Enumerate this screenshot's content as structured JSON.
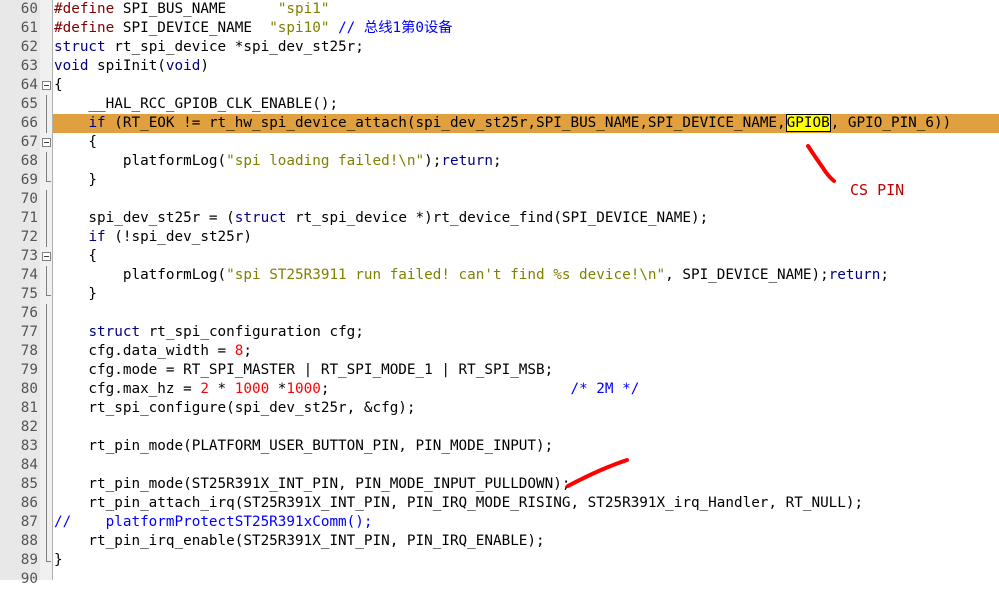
{
  "editor": {
    "lines": [
      {
        "num": "60",
        "fold": "none",
        "tokens": [
          {
            "t": "#define ",
            "c": "pp"
          },
          {
            "t": "SPI_BUS_NAME      ",
            "c": "op"
          },
          {
            "t": "\"spi1\"",
            "c": "str"
          }
        ]
      },
      {
        "num": "61",
        "fold": "none",
        "tokens": [
          {
            "t": "#define ",
            "c": "pp"
          },
          {
            "t": "SPI_DEVICE_NAME  ",
            "c": "op"
          },
          {
            "t": "\"spi10\"",
            "c": "str"
          },
          {
            "t": " // 总线1第0设备",
            "c": "cm"
          }
        ]
      },
      {
        "num": "62",
        "fold": "none",
        "tokens": [
          {
            "t": "struct",
            "c": "kw"
          },
          {
            "t": " rt_spi_device ",
            "c": "op"
          },
          {
            "t": "*",
            "c": "op"
          },
          {
            "t": "spi_dev_st25r;",
            "c": "op"
          }
        ]
      },
      {
        "num": "63",
        "fold": "none",
        "tokens": [
          {
            "t": "void",
            "c": "kw"
          },
          {
            "t": " spiInit(",
            "c": "op"
          },
          {
            "t": "void",
            "c": "kw"
          },
          {
            "t": ")",
            "c": "op"
          }
        ]
      },
      {
        "num": "64",
        "fold": "box",
        "tokens": [
          {
            "t": "{",
            "c": "op"
          }
        ]
      },
      {
        "num": "65",
        "fold": "line",
        "tokens": [
          {
            "t": "    __HAL_RCC_GPIOB_CLK_ENABLE();",
            "c": "op"
          }
        ]
      },
      {
        "num": "66",
        "fold": "line",
        "hl": true,
        "tokens": [
          {
            "t": "    ",
            "c": "op"
          },
          {
            "t": "if",
            "c": "kw"
          },
          {
            "t": " (RT_EOK != rt_hw_spi_device_attach(spi_dev_st25r,SPI_BUS_NAME,SPI_DEVICE_NAME,",
            "c": "op"
          },
          {
            "t": "GPIOB",
            "c": "gsel"
          },
          {
            "t": ", GPIO_PIN_6))",
            "c": "op"
          }
        ]
      },
      {
        "num": "67",
        "fold": "box",
        "tokens": [
          {
            "t": "    {",
            "c": "op"
          }
        ]
      },
      {
        "num": "68",
        "fold": "line",
        "tokens": [
          {
            "t": "        platformLog(",
            "c": "op"
          },
          {
            "t": "\"spi loading failed!\\n\"",
            "c": "str"
          },
          {
            "t": ");",
            "c": "op"
          },
          {
            "t": "return",
            "c": "kw"
          },
          {
            "t": ";",
            "c": "op"
          }
        ]
      },
      {
        "num": "69",
        "fold": "end",
        "tokens": [
          {
            "t": "    }",
            "c": "op"
          }
        ]
      },
      {
        "num": "70",
        "fold": "line",
        "tokens": []
      },
      {
        "num": "71",
        "fold": "line",
        "tokens": [
          {
            "t": "    spi_dev_st25r = (",
            "c": "op"
          },
          {
            "t": "struct",
            "c": "kw"
          },
          {
            "t": " rt_spi_device *)rt_device_find(SPI_DEVICE_NAME);",
            "c": "op"
          }
        ]
      },
      {
        "num": "72",
        "fold": "line",
        "tokens": [
          {
            "t": "    ",
            "c": "op"
          },
          {
            "t": "if",
            "c": "kw"
          },
          {
            "t": " (!spi_dev_st25r)",
            "c": "op"
          }
        ]
      },
      {
        "num": "73",
        "fold": "box",
        "tokens": [
          {
            "t": "    {",
            "c": "op"
          }
        ]
      },
      {
        "num": "74",
        "fold": "line",
        "tokens": [
          {
            "t": "        platformLog(",
            "c": "op"
          },
          {
            "t": "\"spi ST25R3911 run failed! can't find %s device!\\n\"",
            "c": "str"
          },
          {
            "t": ", SPI_DEVICE_NAME);",
            "c": "op"
          },
          {
            "t": "return",
            "c": "kw"
          },
          {
            "t": ";",
            "c": "op"
          }
        ]
      },
      {
        "num": "75",
        "fold": "end",
        "tokens": [
          {
            "t": "    }",
            "c": "op"
          }
        ]
      },
      {
        "num": "76",
        "fold": "line",
        "tokens": []
      },
      {
        "num": "77",
        "fold": "line",
        "tokens": [
          {
            "t": "    ",
            "c": "op"
          },
          {
            "t": "struct",
            "c": "kw"
          },
          {
            "t": " rt_spi_configuration cfg;",
            "c": "op"
          }
        ]
      },
      {
        "num": "78",
        "fold": "line",
        "tokens": [
          {
            "t": "    cfg.data_width = ",
            "c": "op"
          },
          {
            "t": "8",
            "c": "num"
          },
          {
            "t": ";",
            "c": "op"
          }
        ]
      },
      {
        "num": "79",
        "fold": "line",
        "tokens": [
          {
            "t": "    cfg.mode = RT_SPI_MASTER | RT_SPI_MODE_1 | RT_SPI_MSB;",
            "c": "op"
          }
        ]
      },
      {
        "num": "80",
        "fold": "line",
        "tokens": [
          {
            "t": "    cfg.max_hz = ",
            "c": "op"
          },
          {
            "t": "2",
            "c": "num"
          },
          {
            "t": " * ",
            "c": "op"
          },
          {
            "t": "1000",
            "c": "num"
          },
          {
            "t": " *",
            "c": "op"
          },
          {
            "t": "1000",
            "c": "num"
          },
          {
            "t": ";                            ",
            "c": "op"
          },
          {
            "t": "/* 2M */",
            "c": "cm"
          }
        ]
      },
      {
        "num": "81",
        "fold": "line",
        "tokens": [
          {
            "t": "    rt_spi_configure(spi_dev_st25r, &cfg);",
            "c": "op"
          }
        ]
      },
      {
        "num": "82",
        "fold": "line",
        "tokens": []
      },
      {
        "num": "83",
        "fold": "line",
        "tokens": [
          {
            "t": "    rt_pin_mode(PLATFORM_USER_BUTTON_PIN, PIN_MODE_INPUT);",
            "c": "op"
          }
        ]
      },
      {
        "num": "84",
        "fold": "line",
        "tokens": []
      },
      {
        "num": "85",
        "fold": "line",
        "tokens": [
          {
            "t": "    rt_pin_mode(ST25R391X_INT_PIN, PIN_MODE_INPUT_PULLDOWN);",
            "c": "op"
          }
        ]
      },
      {
        "num": "86",
        "fold": "line",
        "tokens": [
          {
            "t": "    rt_pin_attach_irq(ST25R391X_INT_PIN, PIN_IRQ_MODE_RISING, ST25R391X_irq_Handler, RT_NULL);",
            "c": "op"
          }
        ]
      },
      {
        "num": "87",
        "fold": "line",
        "tokens": [
          {
            "t": "//    platformProtectST25R391xComm();",
            "c": "cm"
          }
        ]
      },
      {
        "num": "88",
        "fold": "line",
        "tokens": [
          {
            "t": "    rt_pin_irq_enable(ST25R391X_INT_PIN, PIN_IRQ_ENABLE);",
            "c": "op"
          }
        ]
      },
      {
        "num": "89",
        "fold": "end",
        "tokens": [
          {
            "t": "}",
            "c": "op"
          }
        ]
      },
      {
        "num": "90",
        "fold": "none",
        "tokens": []
      }
    ]
  },
  "annotation": {
    "label": "CS PIN",
    "color": "#ff0000"
  },
  "colors": {
    "highlight_line": "#e0a040",
    "selection": "#ffff00",
    "keyword": "#000080",
    "string": "#808000",
    "number": "#ff0000",
    "comment": "#0000ff",
    "preprocessor": "#800000"
  }
}
